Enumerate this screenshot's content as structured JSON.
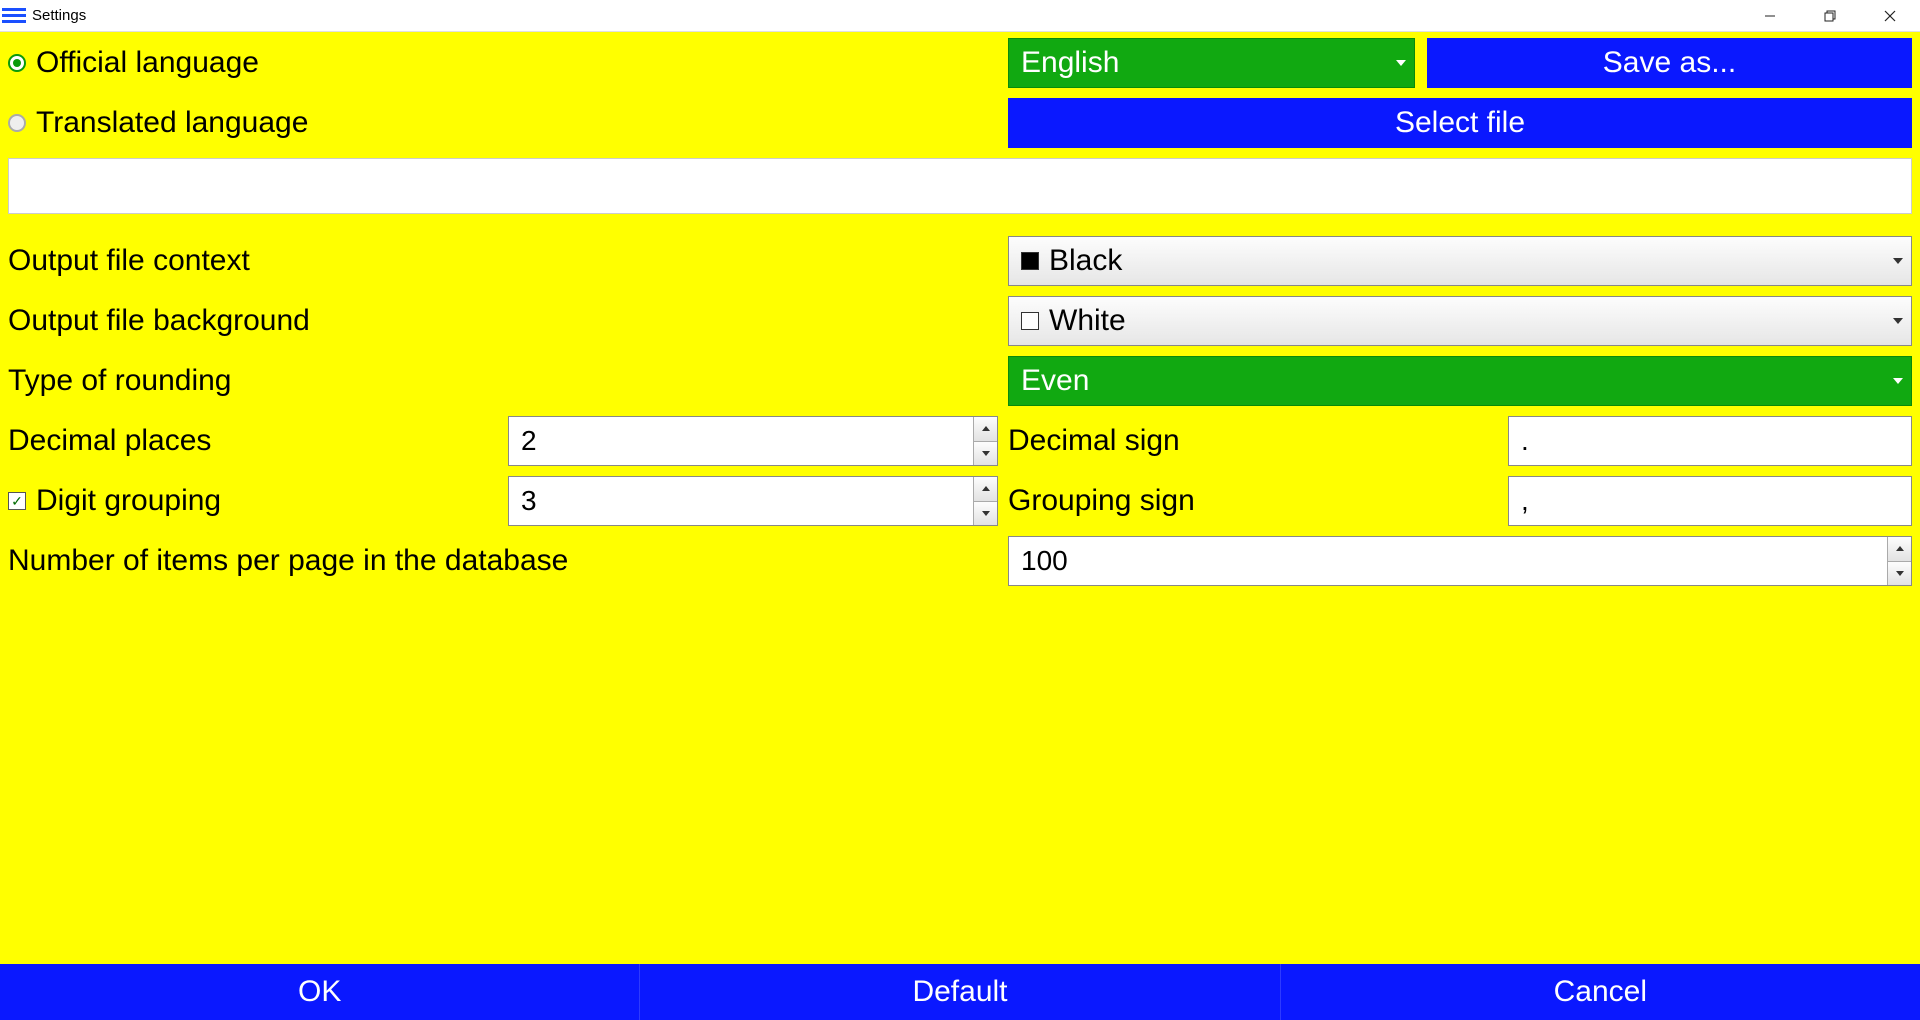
{
  "window": {
    "title": "Settings"
  },
  "lang": {
    "official_label": "Official language",
    "translated_label": "Translated language",
    "official_value": "English",
    "save_as_label": "Save as...",
    "select_file_label": "Select file"
  },
  "output": {
    "context_label": "Output file context",
    "context_value": "Black",
    "background_label": "Output file background",
    "background_value": "White"
  },
  "rounding": {
    "type_label": "Type of rounding",
    "type_value": "Even"
  },
  "decimal": {
    "places_label": "Decimal places",
    "places_value": "2",
    "sign_label": "Decimal sign",
    "sign_value": "."
  },
  "grouping": {
    "digit_label": "Digit grouping",
    "digit_value": "3",
    "sign_label": "Grouping sign",
    "sign_value": ","
  },
  "paging": {
    "label": "Number of items per page in the database",
    "value": "100"
  },
  "footer": {
    "ok": "OK",
    "default": "Default",
    "cancel": "Cancel"
  }
}
